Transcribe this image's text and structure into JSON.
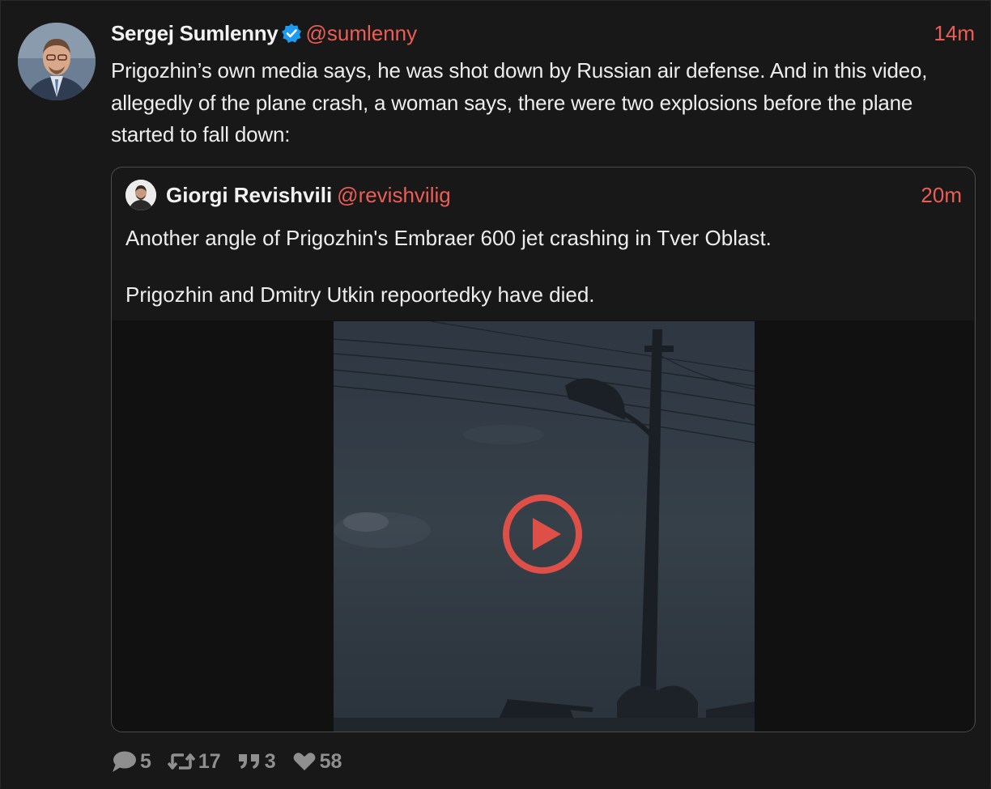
{
  "post": {
    "author": {
      "display_name": "Sergej Sumlenny",
      "handle": "@sumlenny",
      "verified": true
    },
    "timestamp": "14m",
    "text": "Prigozhin’s own media says, he was shot down by Russian air defense. And in this video, allegedly of the plane crash, a woman says, there were two explosions before the plane started to fall down:"
  },
  "quote": {
    "author": {
      "display_name": "Giorgi Revishvili",
      "handle": "@revishvilig"
    },
    "timestamp": "20m",
    "text_lines": [
      "Another angle of Prigozhin's Embraer 600 jet crashing in Tver Oblast.",
      "Prigozhin and Dmitry Utkin repoortedky have died."
    ]
  },
  "actions": {
    "replies": "5",
    "reposts": "17",
    "quotes": "3",
    "likes": "58"
  },
  "colors": {
    "accent": "#ec5e55",
    "verified": "#1d9bf0",
    "background": "#181818",
    "muted": "#8f8f8f"
  },
  "icons": {
    "verified": "verified-badge-icon",
    "play": "play-icon",
    "reply": "speech-bubble-icon",
    "repost": "repost-icon",
    "quote": "quote-icon",
    "like": "heart-icon"
  }
}
